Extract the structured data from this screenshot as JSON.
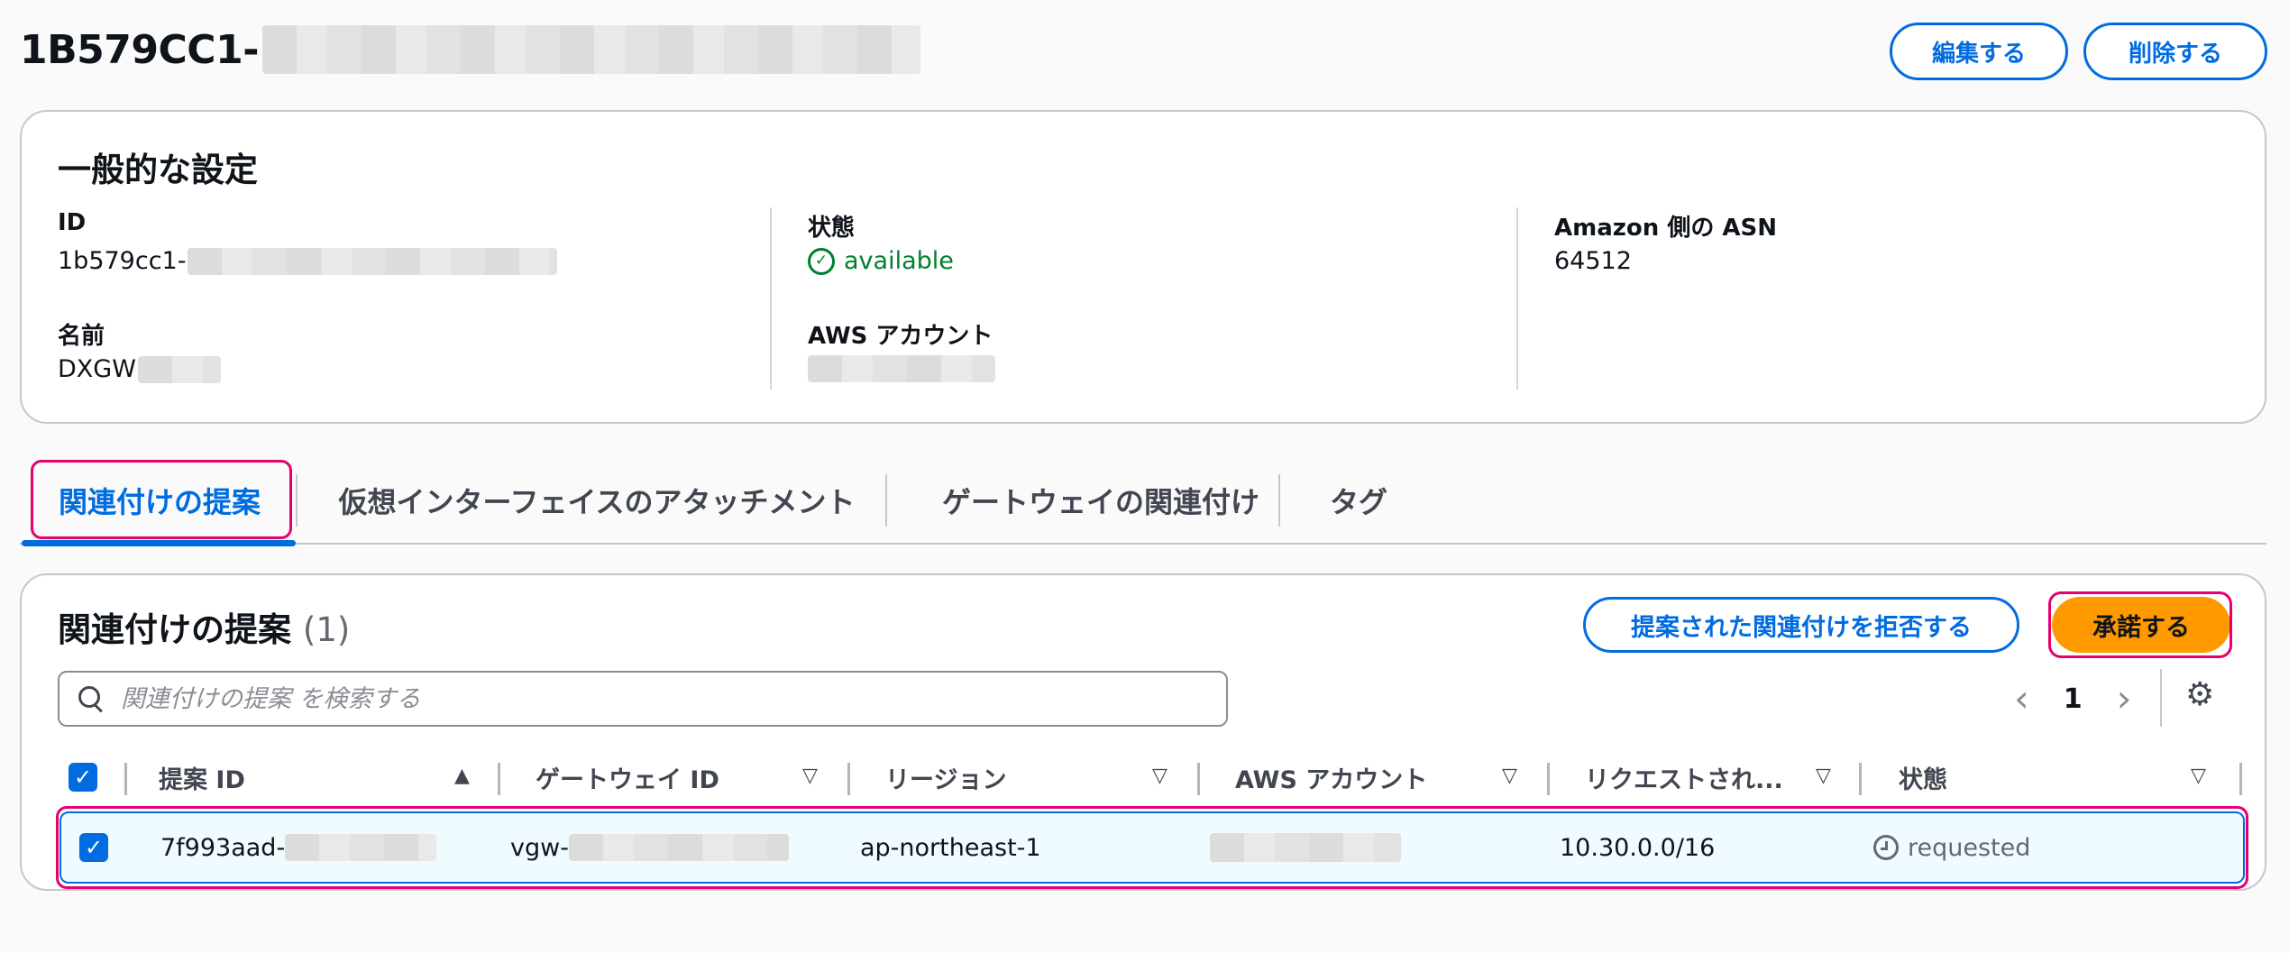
{
  "header": {
    "title": "1B579CC1-",
    "edit_label": "編集する",
    "delete_label": "削除する"
  },
  "general": {
    "title": "一般的な設定",
    "id_label": "ID",
    "id_value": "1b579cc1-",
    "name_label": "名前",
    "name_value": "DXGW",
    "state_label": "状態",
    "state_value": "available",
    "account_label": "AWS アカウント",
    "asn_label": "Amazon 側の ASN",
    "asn_value": "64512"
  },
  "tabs": [
    {
      "label": "関連付けの提案",
      "active": true
    },
    {
      "label": "仮想インターフェイスのアタッチメント",
      "active": false
    },
    {
      "label": "ゲートウェイの関連付け",
      "active": false
    },
    {
      "label": "タグ",
      "active": false
    }
  ],
  "proposals": {
    "title": "関連付けの提案",
    "count": "(1)",
    "reject_label": "提案された関連付けを拒否する",
    "accept_label": "承諾する",
    "search_placeholder": "関連付けの提案 を検索する",
    "page": "1",
    "columns": [
      "提案 ID",
      "ゲートウェイ ID",
      "リージョン",
      "AWS アカウント",
      "リクエストされ...",
      "状態"
    ],
    "rows": [
      {
        "proposal_id": "7f993aad-",
        "gateway_id": "vgw-",
        "region": "ap-northeast-1",
        "account": "",
        "requested": "10.30.0.0/16",
        "state": "requested",
        "selected": true
      }
    ]
  },
  "colors": {
    "accent": "#006ce0",
    "primary_button": "#ff9900",
    "success": "#00802f",
    "highlight": "#e5006b"
  }
}
